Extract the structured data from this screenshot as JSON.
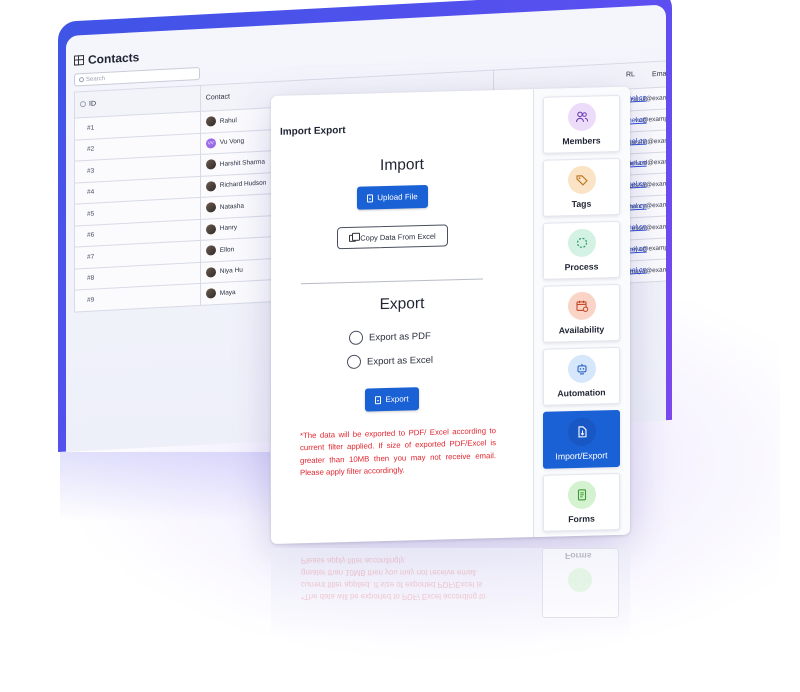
{
  "contacts": {
    "title": "Contacts",
    "search_placeholder": "Search",
    "columns": {
      "id": "ID",
      "contact": "Contact",
      "email": "Emai",
      "url": "RL"
    },
    "rows": [
      {
        "id": "#1",
        "name": "Rahul",
        "email": "rahul@exam",
        "url": "nnel.co"
      },
      {
        "id": "#2",
        "name": "Vu Vong",
        "email": "vu@examp",
        "url": "nnel.co",
        "initials": "VV"
      },
      {
        "id": "#3",
        "name": "Harshit Sharma",
        "email": "harshit@exan",
        "url": "nnel.co"
      },
      {
        "id": "#4",
        "name": "Richard Hudson",
        "email": "richard@exan",
        "url": "nnel.co"
      },
      {
        "id": "#5",
        "name": "Natasha",
        "email": "natsha@exam",
        "url": "nnel.co"
      },
      {
        "id": "#6",
        "name": "Hanry",
        "email": "hanry@exam",
        "url": "nnel.co"
      },
      {
        "id": "#7",
        "name": "Ellon",
        "email": "ellon@exam",
        "url": "nnel.co"
      },
      {
        "id": "#8",
        "name": "Niya Hu",
        "email": "niya@examp",
        "url": "nnel.co"
      },
      {
        "id": "#9",
        "name": "Maya",
        "email": "maya@exam",
        "url": "nnel.co"
      }
    ]
  },
  "dialog": {
    "title": "Import Export",
    "import_heading": "Import",
    "upload_label": "Upload File",
    "copy_label": "Copy Data From Excel",
    "export_heading": "Export",
    "export_pdf": "Export as PDF",
    "export_excel": "Export as Excel",
    "export_button": "Export",
    "note": "*The data will be exported to PDF/ Excel according to current filter applied. If size of exported PDF/Excel is greater than 10MB then you may not receive email. Please apply filter accordingly."
  },
  "sidebar": {
    "items": [
      {
        "label": "Members",
        "icon": "members-icon",
        "color": "#ecdcf9"
      },
      {
        "label": "Tags",
        "icon": "tag-icon",
        "color": "#fbe3c6"
      },
      {
        "label": "Process",
        "icon": "process-icon",
        "color": "#d3f2e4"
      },
      {
        "label": "Availability",
        "icon": "calendar-icon",
        "color": "#fbd4c8"
      },
      {
        "label": "Automation",
        "icon": "robot-icon",
        "color": "#d6e6fb"
      },
      {
        "label": "Import/Export",
        "icon": "import-export-icon",
        "color": "#1857c4",
        "active": true
      },
      {
        "label": "Forms",
        "icon": "form-icon",
        "color": "#d4f2cf"
      }
    ]
  },
  "accent_color": "#1a61d6",
  "note_color": "#e0262f"
}
